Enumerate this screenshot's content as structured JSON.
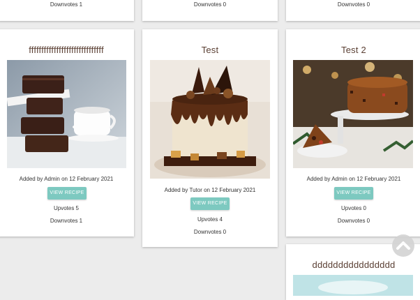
{
  "top_row": [
    {
      "downvotes": "Downvotes 1"
    },
    {
      "downvotes": "Downvotes 0"
    },
    {
      "downvotes": "Downvotes 0"
    }
  ],
  "cards": [
    {
      "title": "ffffffffffffffffffffffffffffff",
      "added": "Added by Admin on 12 February 2021",
      "button": "VIEW RECIPE",
      "upvotes": "Upvotes 5",
      "downvotes": "Downvotes 1"
    },
    {
      "title": "Test",
      "added": "Added by Tutor on 12 February 2021",
      "button": "VIEW RECIPE",
      "upvotes": "Upvotes 4",
      "downvotes": "Downvotes 0"
    },
    {
      "title": "Test 2",
      "added": "Added by Admin on 12 February 2021",
      "button": "VIEW RECIPE",
      "upvotes": "Upvotes 0",
      "downvotes": "Downvotes 0"
    },
    {
      "title": "dddddddddddddddd"
    }
  ],
  "colors": {
    "accent": "#7dc9c0",
    "title": "#5a3f33"
  },
  "icons": {
    "scroll_top": "chevron-up-icon"
  }
}
